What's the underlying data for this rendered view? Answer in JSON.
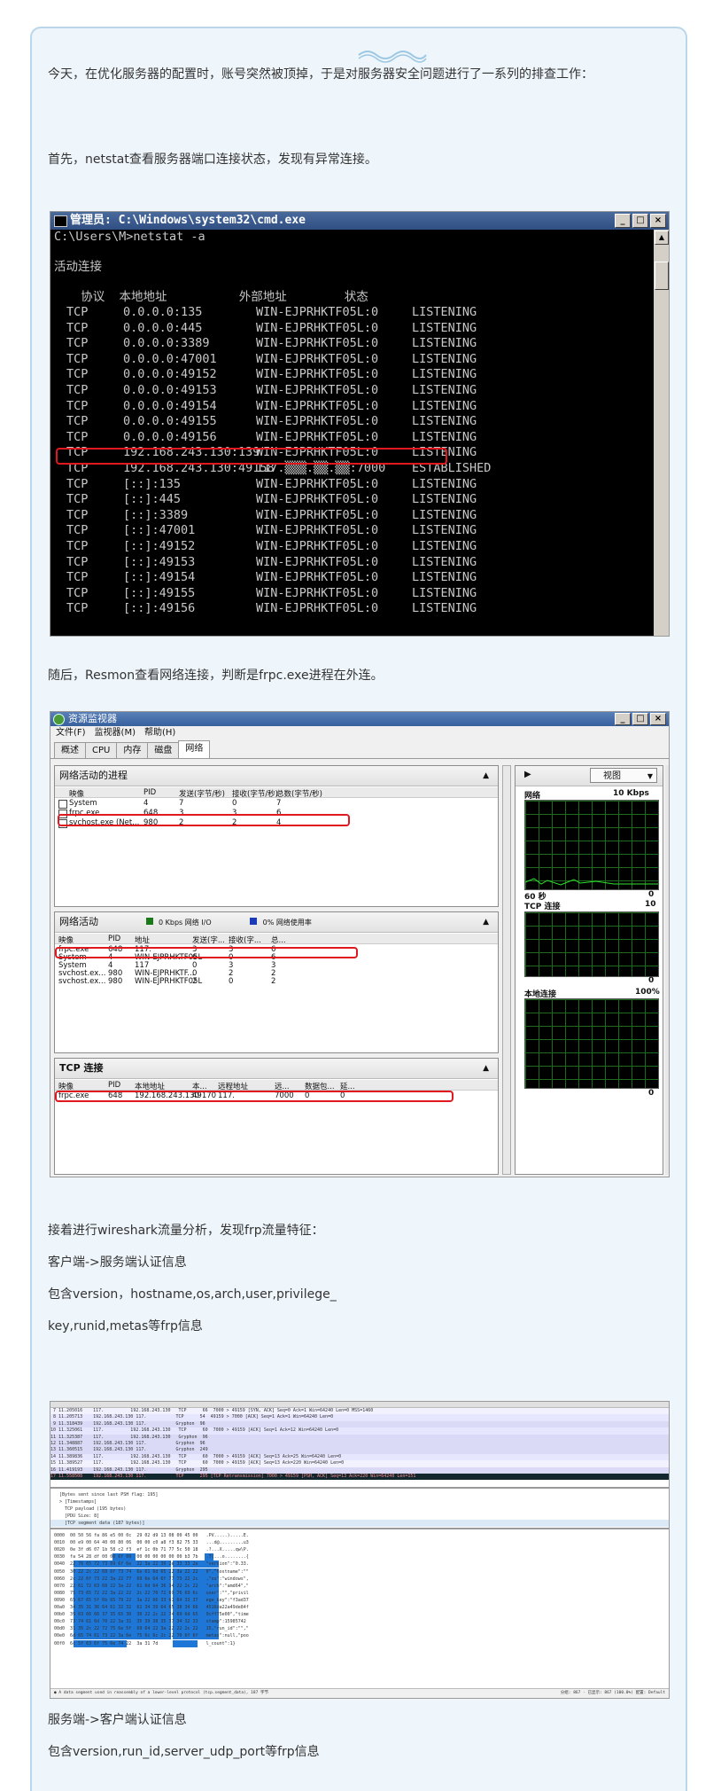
{
  "article": {
    "p1": "今天，在优化服务器的配置时，账号突然被顶掉，于是对服务器安全问题进行了一系列的排查工作：",
    "p2": "首先，netstat查看服务器端口连接状态，发现有异常连接。",
    "p3": "随后，Resmon查看网络连接，判断是frpc.exe进程在外连。",
    "p4": "接着进行wireshark流量分析，发现frp流量特征：",
    "p5": "客户端->服务端认证信息",
    "p6": "包含version，hostname,os,arch,user,privilege_",
    "p7": "key,runid,metas等frp信息",
    "p8": "服务端->客户端认证信息",
    "p9": "包含version,run_id,server_udp_port等frp信息"
  },
  "cmd": {
    "title": "管理员: C:\\Windows\\system32\\cmd.exe",
    "prompt": "C:\\Users\\M>netstat -a",
    "heading": "活动连接",
    "columns": "  协议  本地地址          外部地址        状态",
    "rows": [
      [
        "TCP",
        "0.0.0.0:135",
        "WIN-EJPRHKTF05L:0",
        "LISTENING"
      ],
      [
        "TCP",
        "0.0.0.0:445",
        "WIN-EJPRHKTF05L:0",
        "LISTENING"
      ],
      [
        "TCP",
        "0.0.0.0:3389",
        "WIN-EJPRHKTF05L:0",
        "LISTENING"
      ],
      [
        "TCP",
        "0.0.0.0:47001",
        "WIN-EJPRHKTF05L:0",
        "LISTENING"
      ],
      [
        "TCP",
        "0.0.0.0:49152",
        "WIN-EJPRHKTF05L:0",
        "LISTENING"
      ],
      [
        "TCP",
        "0.0.0.0:49153",
        "WIN-EJPRHKTF05L:0",
        "LISTENING"
      ],
      [
        "TCP",
        "0.0.0.0:49154",
        "WIN-EJPRHKTF05L:0",
        "LISTENING"
      ],
      [
        "TCP",
        "0.0.0.0:49155",
        "WIN-EJPRHKTF05L:0",
        "LISTENING"
      ],
      [
        "TCP",
        "0.0.0.0:49156",
        "WIN-EJPRHKTF05L:0",
        "LISTENING"
      ],
      [
        "TCP",
        "192.168.243.130:139",
        "WIN-EJPRHKTF05L:0",
        "LISTENING"
      ],
      [
        "TCP",
        "192.168.243.130:49158",
        "117.▒▒▒.▒▒.▒▒:7000",
        "ESTABLISHED"
      ],
      [
        "TCP",
        "[::]:135",
        "WIN-EJPRHKTF05L:0",
        "LISTENING"
      ],
      [
        "TCP",
        "[::]:445",
        "WIN-EJPRHKTF05L:0",
        "LISTENING"
      ],
      [
        "TCP",
        "[::]:3389",
        "WIN-EJPRHKTF05L:0",
        "LISTENING"
      ],
      [
        "TCP",
        "[::]:47001",
        "WIN-EJPRHKTF05L:0",
        "LISTENING"
      ],
      [
        "TCP",
        "[::]:49152",
        "WIN-EJPRHKTF05L:0",
        "LISTENING"
      ],
      [
        "TCP",
        "[::]:49153",
        "WIN-EJPRHKTF05L:0",
        "LISTENING"
      ],
      [
        "TCP",
        "[::]:49154",
        "WIN-EJPRHKTF05L:0",
        "LISTENING"
      ],
      [
        "TCP",
        "[::]:49155",
        "WIN-EJPRHKTF05L:0",
        "LISTENING"
      ],
      [
        "TCP",
        "[::]:49156",
        "WIN-EJPRHKTF05L:0",
        "LISTENING"
      ]
    ]
  },
  "resmon": {
    "title": "资源监视器",
    "menu": [
      "文件(F)",
      "监视器(M)",
      "帮助(H)"
    ],
    "tabs": [
      "概述",
      "CPU",
      "内存",
      "磁盘",
      "网络"
    ],
    "proc_panel": {
      "title": "网络活动的进程",
      "headers": [
        "映像",
        "PID",
        "发送(字节/秒)",
        "接收(字节/秒)",
        "总数(字节/秒)"
      ],
      "rows": [
        [
          "System",
          "4",
          "7",
          "0",
          "7"
        ],
        [
          "frpc.exe",
          "648",
          "3",
          "3",
          "6"
        ],
        [
          "svchost.exe (Net...",
          "980",
          "2",
          "2",
          "4"
        ]
      ]
    },
    "net_panel": {
      "title": "网络活动",
      "io": "0 Kbps 网络 I/O",
      "usage": "0% 网络使用率",
      "headers": [
        "映像",
        "PID",
        "地址",
        "发送(字...",
        "接收(字...",
        "总..."
      ],
      "rows": [
        [
          "frpc.exe",
          "648",
          "117.",
          "3",
          "3",
          "6"
        ],
        [
          "System",
          "4",
          "WIN-EJPRHKTF05L",
          "6",
          "0",
          "6"
        ],
        [
          "System",
          "4",
          "117",
          "0",
          "3",
          "3"
        ],
        [
          "svchost.ex...",
          "980",
          "WIN-EJPRHKTF...",
          "0",
          "2",
          "2"
        ],
        [
          "svchost.ex...",
          "980",
          "WIN-EJPRHKTF05L",
          "2",
          "0",
          "2"
        ]
      ]
    },
    "tcp_panel": {
      "title": "TCP 连接",
      "headers": [
        "映像",
        "PID",
        "本地地址",
        "本...",
        "远程地址",
        "远...",
        "数据包...",
        "延..."
      ],
      "rows": [
        [
          "frpc.exe",
          "648",
          "192.168.243.130",
          "49170",
          "117.",
          "7000",
          "0",
          "0"
        ]
      ]
    },
    "right": {
      "view": "视图",
      "net_label": "网络",
      "net_scale": "10 Kbps",
      "sixty": "60 秒",
      "zero": "0",
      "tcp_label": "TCP 连接",
      "tcp_scale": "10",
      "local_label": "本地连接",
      "local_scale": "100%"
    }
  },
  "wireshark": {
    "packets": [
      " 7 11.205016    117.          192.168.243.130   TCP      66  7000 > 49159 [SYN, ACK] Seq=0 Ack=1 Win=64240 Len=0 MSS=1460",
      " 8 11.205713    192.168.243.130 117.           TCP      54  49159 > 7000 [ACK] Seq=1 Ack=1 Win=64240 Len=0",
      " 9 11.318439    192.168.243.130 117.           Gryphon  96",
      "10 11.325061    117.          192.168.243.130   TCP      60  7000 > 49159 [ACK] Seq=1 Ack=12 Win=64240 Len=0",
      "11 11.325387    117.          192.168.243.130   Gryphon  96",
      "12 11.348887    192.168.243.130 117.           Gryphon  96",
      "13 11.360515    192.168.243.130 117.           Gryphon  249",
      "14 11.389836    117.          192.168.243.130   TCP      60  7000 > 49159 [ACK] Seq=13 Ack=25 Win=64240 Len=0",
      "15 11.389527    117.          192.168.243.130   TCP      60  7000 > 49159 [ACK] Seq=13 Ack=220 Win=64240 Len=0",
      "16 11.419193    192.168.243.130 117.           Gryphon  295",
      "17 11.558508    192.168.243.130 117.           TCP      295 [TCP Retransmission] 7000 > 49159 [PSH, ACK] Seq=13 Ack=220 Win=64240 Len=151"
    ],
    "details": [
      "[Bytes sent since last PSH flag: 195]",
      "> [Timestamps]",
      "  TCP payload (195 bytes)",
      "  [PDU Size: 8]",
      "  [TCP segment data (187 bytes)]"
    ],
    "hex": [
      "0000  00 50 56 fa 86 e5 00 0c  29 02 d9 13 08 00 45 00   .PV.....).....E.",
      "0010  00 e9 00 64 40 00 80 06  00 00 c0 a8 f3 82 75 33   ...d@.........u3",
      "0020  0e 3f d6 07 1b 58 c2 f3  ef 1c 0b 71 77 5c 50 18   .?...X.....qw\\P.",
      "0030  fa 54 28 df 00 00 6f 00  00 00 00 00 00 00 b3 7b   .T(...o........{",
      "0040  22 76 65 72 73 69 6f 6e  22 3a 22 30 2e 33 33 2e   \"version\":\"0.33.",
      "0050  30 22 2c 22 68 6f 73 74  6e 61 6d 65 22 3a 22 22   0\",\"hostname\":\"\"",
      "0060  2c 22 6f 73 22 3a 22 77  69 6e 64 6f 77 73 22 2c   ,\"os\":\"windows\",",
      "0070  22 61 72 63 68 22 3a 22  61 6d 64 36 34 22 2c 22   \"arch\":\"amd64\",\"",
      "0080  75 73 65 72 22 3a 22 22  2c 22 70 72 69 76 69 6c   user\":\"\",\"privil",
      "0090  65 67 65 5f 6b 65 79 22  3a 22 66 33 61 64 33 37   ege_key\":\"f3ad37",
      "00a0  34 35 31 36 64 61 32 32  61 34 39 64 65 38 34 66   4516da22a49de84f",
      "00b0  39 63 66 66 37 35 65 30  30 22 2c 22 74 69 6d 65   9cff75e00\",\"time",
      "00c0  73 74 61 6d 70 22 3a 31  35 39 38 35 37 34 32 33   stamp\":15985742",
      "00d0  31 35 2c 22 72 75 6e 5f  69 64 22 3a 22 22 2c 22   15,\"run_id\":\"\",\"",
      "00e0  6d 65 74 61 73 22 3a 6e  75 6c 6c 2c 22 70 6f 6f   metas\":null,\"poo",
      "00f0  6c 5f 63 6f 75 6e 74 22  3a 31 7d                  l_count\":1}"
    ],
    "status_left": "● A data segment used in reassembly of a lower-level protocol (tcp.segment_data), 187 字节",
    "status_right": "分组: 867 · 已显示: 867 (100.0%)        配置: Default"
  }
}
